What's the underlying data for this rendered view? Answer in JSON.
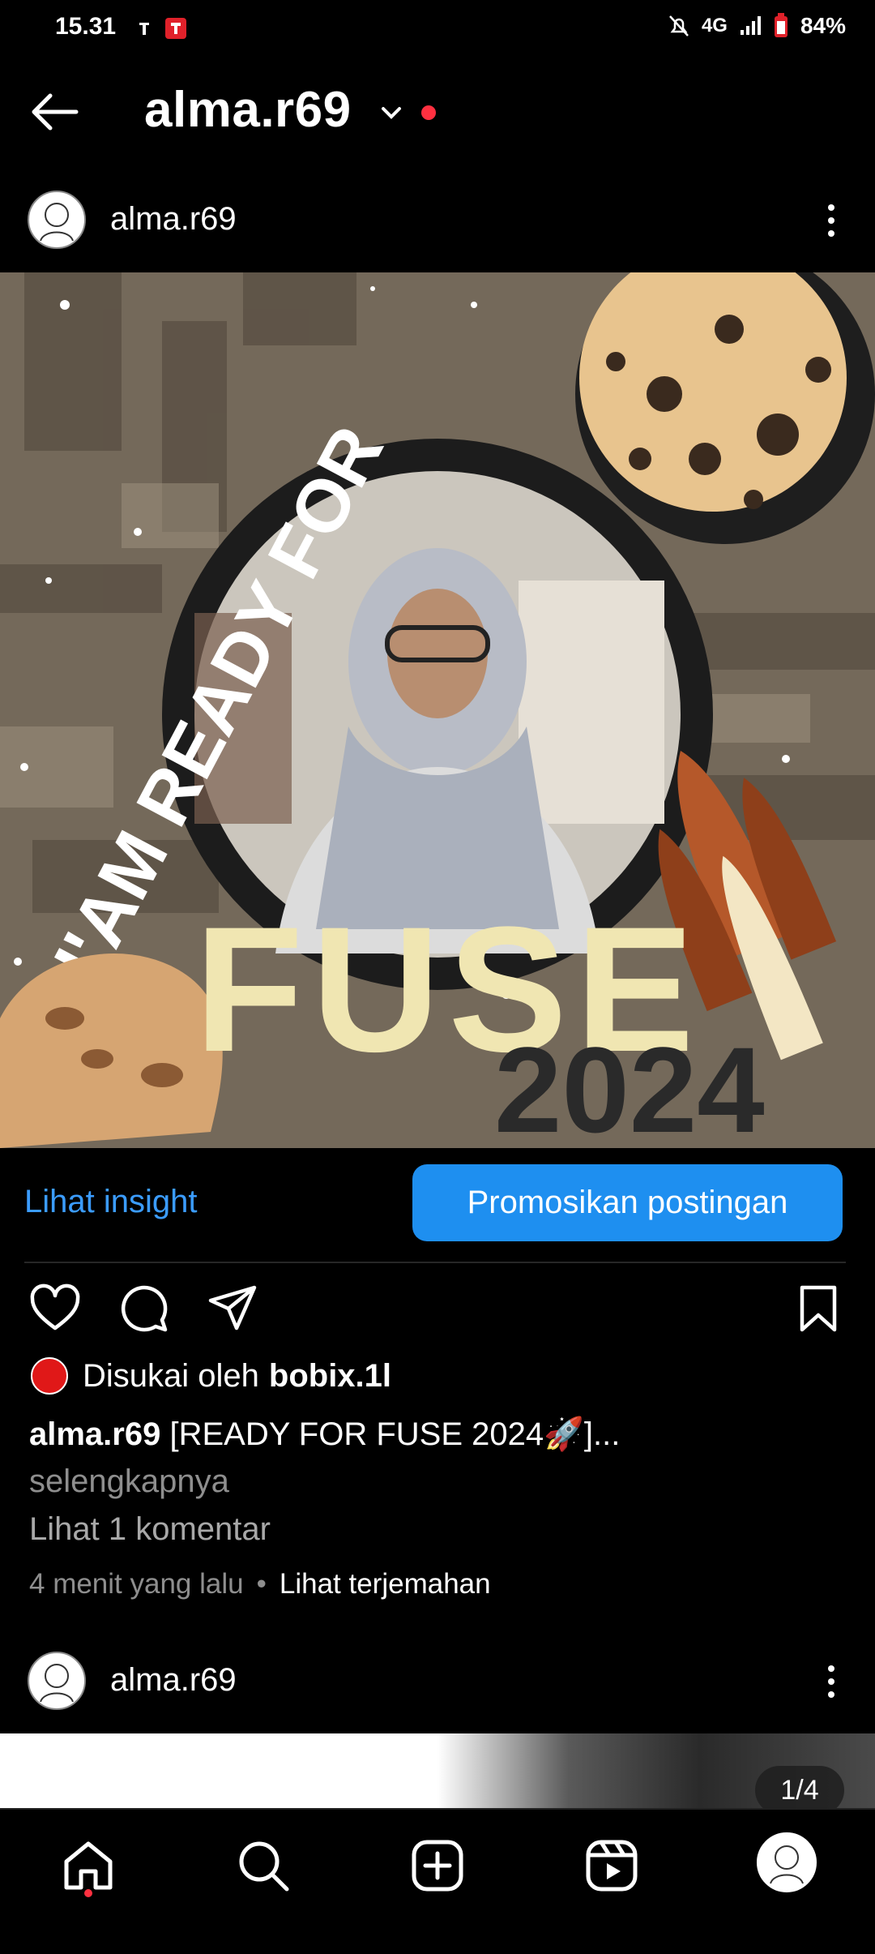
{
  "status_bar": {
    "time": "15.31",
    "network": "4G",
    "battery": "84%"
  },
  "header": {
    "title": "alma.r69"
  },
  "post": {
    "username": "alma.r69",
    "image": {
      "headline": "I'AM READY FOR",
      "event": "FUSE",
      "year": "2024"
    },
    "insight_label": "Lihat insight",
    "promote_label": "Promosikan postingan",
    "likes_prefix": "Disukai oleh",
    "likes_user": "bobix.1l",
    "caption_user": "alma.r69",
    "caption_text": "[READY FOR FUSE 2024🚀]...",
    "caption_more": "selengkapnya",
    "comments_label": "Lihat 1 komentar",
    "time_ago": "4 menit yang lalu",
    "translate_label": "Lihat terjemahan"
  },
  "post2": {
    "username": "alma.r69",
    "counter": "1/4"
  },
  "colors": {
    "accent": "#1e8ff0",
    "link": "#3b9cff",
    "notification": "#ff3040"
  },
  "nav_icons": [
    "home-icon",
    "search-icon",
    "create-icon",
    "reels-icon",
    "profile-avatar"
  ]
}
